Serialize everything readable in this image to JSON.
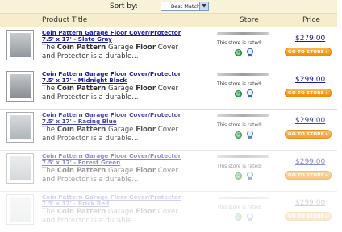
{
  "sort": {
    "label": "Sort by:",
    "selected": "Best Match"
  },
  "columns": {
    "title": "Product Title",
    "store": "Store",
    "price": "Price"
  },
  "rating_label": "This store is rated:",
  "goto_label": "GO TO STORE ▸",
  "items": [
    {
      "title_line1": "Coin Pattern Garage Floor  Cover/Protector",
      "title_line2": "7.5' x 17' - Slate Gray",
      "desc_before": "The ",
      "desc_bold1": "Coin Pattern",
      "desc_mid": " Garage ",
      "desc_bold2": "Floor",
      "desc_after": " Cover and Protector is a durable...",
      "price": "$279.00"
    },
    {
      "title_line1": "Coin Pattern Garage Floor  Cover/Protector",
      "title_line2": "7.5' x 17' - Midnight Black",
      "desc_before": "The ",
      "desc_bold1": "Coin Pattern",
      "desc_mid": " Garage ",
      "desc_bold2": "Floor",
      "desc_after": " Cover and Protector is a durable...",
      "price": "$299.00"
    },
    {
      "title_line1": "Coin Pattern Garage Floor  Cover/Protector",
      "title_line2": "7.5' x 17' - Racing Blue",
      "desc_before": "The ",
      "desc_bold1": "Coin Pattern",
      "desc_mid": " Garage ",
      "desc_bold2": "Floor",
      "desc_after": " Cover and Protector is a durable...",
      "price": "$299.00"
    },
    {
      "title_line1": "Coin Pattern Garage Floor  Cover/Protector",
      "title_line2": "7.5' x 17' - Forest Green",
      "desc_before": "The ",
      "desc_bold1": "Coin Pattern",
      "desc_mid": " Garage ",
      "desc_bold2": "Floor",
      "desc_after": " Cover and Protector is a durable...",
      "price": "$299.00"
    },
    {
      "title_line1": "Coin Pattern Garage Floor  Cover/Protector",
      "title_line2": "7.5' x 17' - Brick Red",
      "desc_before": "The ",
      "desc_bold1": "Coin Pattern",
      "desc_mid": " Garage ",
      "desc_bold2": "Floor",
      "desc_after": " Cover and Protector is a durable...",
      "price": "$299.00"
    }
  ],
  "icons": {
    "rating_smile": "smile-icon",
    "rating_medal": "medal-icon",
    "dropdown": "chevron-down-icon"
  },
  "colors": {
    "link": "#1a1aa6",
    "accent_orange": "#f28c00",
    "header_bg": "#f5edcc",
    "rating_green": "#34a853"
  }
}
